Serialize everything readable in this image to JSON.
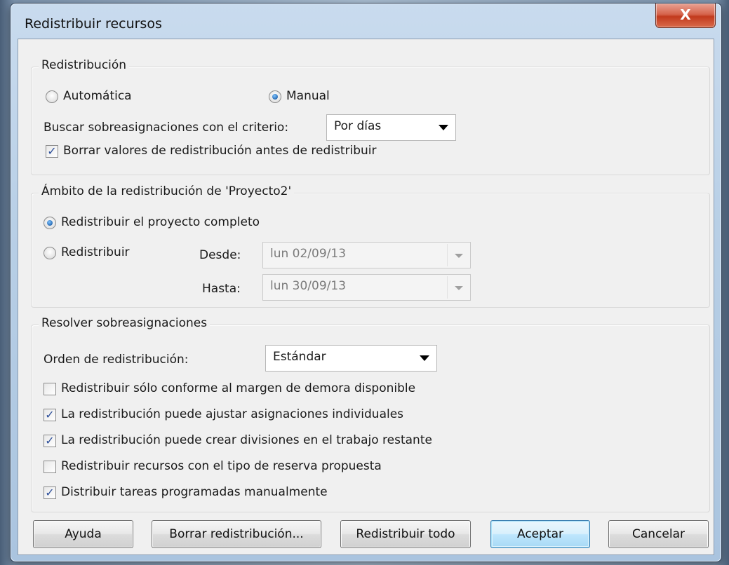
{
  "window": {
    "title": "Redistribuir recursos",
    "close_glyph": "X"
  },
  "redistribucion": {
    "legend": "Redistribución",
    "auto_label": "Automática",
    "manual_label": "Manual",
    "mode_selected": "Manual",
    "criterio_label": "Buscar sobreasignaciones con el criterio:",
    "criterio_value": "Por días",
    "borrar_label": "Borrar valores de redistribución antes de redistribuir",
    "borrar_checked": true
  },
  "ambito": {
    "legend": "Ámbito de la redistribución de 'Proyecto2'",
    "completo_label": "Redistribuir el proyecto completo",
    "rango_label": "Redistribuir",
    "selected": "completo",
    "desde_label": "Desde:",
    "desde_value": "lun 02/09/13",
    "hasta_label": "Hasta:",
    "hasta_value": "lun 30/09/13"
  },
  "resolver": {
    "legend": "Resolver sobreasignaciones",
    "orden_label": "Orden de redistribución:",
    "orden_value": "Estándar",
    "options": [
      {
        "label": "Redistribuir sólo conforme al margen de demora disponible",
        "checked": false
      },
      {
        "label": "La redistribución puede ajustar asignaciones individuales",
        "checked": true
      },
      {
        "label": "La redistribución puede crear divisiones en el trabajo restante",
        "checked": true
      },
      {
        "label": "Redistribuir recursos con el tipo de reserva propuesta",
        "checked": false
      },
      {
        "label": "Distribuir tareas programadas manualmente",
        "checked": true
      }
    ]
  },
  "buttons": {
    "ayuda": "Ayuda",
    "borrar": "Borrar redistribución...",
    "todo": "Redistribuir todo",
    "aceptar": "Aceptar",
    "cancelar": "Cancelar"
  },
  "icons": {
    "check_glyph": "✓",
    "close_icon": "close-icon",
    "dropdown_icon": "chevron-down-icon"
  }
}
